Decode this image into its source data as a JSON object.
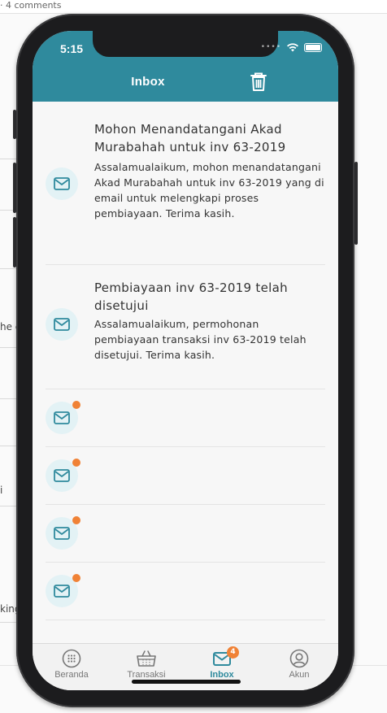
{
  "background": {
    "top_text": "· 4 comments",
    "fragments": [
      "he c",
      "i",
      "king"
    ]
  },
  "status_bar": {
    "time": "5:15"
  },
  "header": {
    "title": "Inbox",
    "trash_icon": "trash-icon"
  },
  "messages": [
    {
      "title": "Mohon Menandatangani Akad Murabahah untuk inv 63-2019",
      "body": "Assalamualaikum, mohon menandatangani Akad Murabahah untuk inv 63-2019 yang di email untuk melengkapi proses pembiayaan. Terima kasih.",
      "unread": false
    },
    {
      "title": "Pembiayaan inv 63-2019 telah disetujui",
      "body": "Assalamualaikum, permohonan pembiayaan transaksi inv 63-2019 telah disetujui. Terima kasih.",
      "unread": false
    },
    {
      "title": "",
      "body": "",
      "unread": true
    },
    {
      "title": "",
      "body": "",
      "unread": true
    },
    {
      "title": "",
      "body": "",
      "unread": true
    },
    {
      "title": "",
      "body": "",
      "unread": true
    }
  ],
  "tabbar": {
    "tabs": [
      {
        "label": "Beranda",
        "icon": "grid-circle-icon",
        "active": false
      },
      {
        "label": "Transaksi",
        "icon": "basket-icon",
        "active": false
      },
      {
        "label": "Inbox",
        "icon": "mail-icon",
        "active": true,
        "badge": "4"
      },
      {
        "label": "Akun",
        "icon": "user-circle-icon",
        "active": false
      }
    ]
  },
  "colors": {
    "header": "#2f8a9d",
    "accent": "#2f8a9d",
    "unread_dot": "#f08236",
    "icon_bg": "#e3f2f5"
  }
}
